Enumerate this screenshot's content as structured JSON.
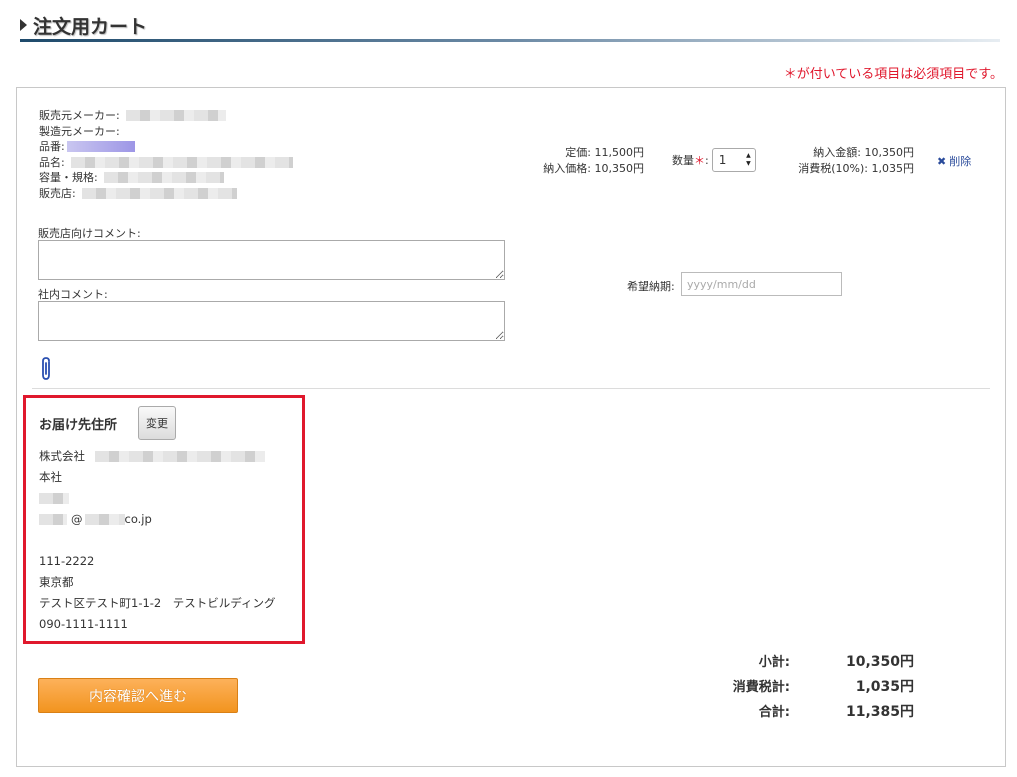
{
  "page": {
    "title": "注文用カート",
    "required_note": "＊が付いている項目は必須項目です。"
  },
  "product": {
    "maker_seller_label": "販売元メーカー:",
    "maker_mfg_label": "製造元メーカー:",
    "part_no_label": "品番:",
    "name_label": "品名:",
    "capacity_label": "容量・規格:",
    "store_label": "販売店:",
    "list_price": "定価: 11,500円",
    "unit_price": "納入価格: 10,350円",
    "qty_label": "数量",
    "qty_required": "＊",
    "qty_colon": ":",
    "qty_value": "1",
    "delivery_amount": "納入金額: 10,350円",
    "tax": "消費税(10%): 1,035円",
    "delete_label": "削除"
  },
  "comments": {
    "store_comment_label": "販売店向けコメント:",
    "internal_comment_label": "社内コメント:",
    "delivery_date_label": "希望納期:",
    "delivery_date_placeholder": "yyyy/mm/dd"
  },
  "shipping": {
    "title": "お届け先住所",
    "change_label": "変更",
    "company_prefix": "株式会社",
    "branch": "本社",
    "email_at": "@",
    "email_domain": "co.jp",
    "postal": "111-2222",
    "prefecture": "東京都",
    "address": "テスト区テスト町1-1-2　テストビルディング",
    "phone": "090-1111-1111"
  },
  "totals": {
    "subtotal_label": "小計:",
    "subtotal_value": "10,350円",
    "tax_label": "消費税計:",
    "tax_value": "1,035円",
    "total_label": "合計:",
    "total_value": "11,385円"
  },
  "actions": {
    "proceed_label": "内容確認へ進む"
  },
  "colors": {
    "required_red": "#e0182d",
    "link_blue": "#2a4b9b",
    "button_orange": "#f2941f"
  }
}
